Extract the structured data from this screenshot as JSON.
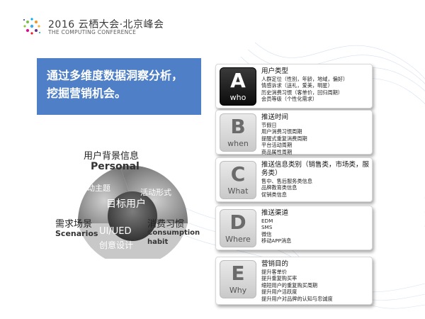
{
  "logo": {
    "title": "2016 云栖大会·北京峰会",
    "subtitle": "THE COMPUTING CONFERENCE"
  },
  "headline": {
    "line1": "通过多维度数据洞察分析，",
    "line2": "挖掘营销机会。"
  },
  "cards": [
    {
      "letter": "A",
      "word": "who",
      "active": true,
      "title": "用户类型",
      "lines": [
        "人群定位（性别，年龄，地域，偏好）",
        "情感诉求（送礼，爱美，明星）",
        "历史消费习惯（客单价，回归周期）",
        "会员等级（个性化需求）"
      ]
    },
    {
      "letter": "B",
      "word": "when",
      "active": false,
      "title": "推送时间",
      "lines": [
        "节假日",
        "用户消费习惯周期",
        "提醒式重复消费周期",
        "平台活动周期",
        "商品属性周期"
      ]
    },
    {
      "letter": "C",
      "word": "What",
      "active": false,
      "title": "推送信息类别（销售类，市场类，服务类）",
      "lines": [
        "售中、售后服务类信息",
        "品牌教育类信息",
        "促销类信息"
      ]
    },
    {
      "letter": "D",
      "word": "Where",
      "active": false,
      "title": "推送渠道",
      "lines": [
        "EDM",
        "SMS",
        "微信",
        "移动APP消息"
      ]
    },
    {
      "letter": "E",
      "word": "Why",
      "active": false,
      "title": "营销目的",
      "lines": [
        "提升客单价",
        "提升重复购买率",
        "缩短用户的重复购买周期",
        "提升用户活跃度",
        "提升用户对品牌的认知与忠诚度"
      ]
    }
  ],
  "diagram": {
    "top_cn": "用户背景信息",
    "top_en": "Personal",
    "center": "目标用户",
    "seg_left": "活动主题",
    "seg_right": "活动形式",
    "left_cn": "需求场景",
    "left_en": "Scenarios",
    "bottom_main": "UI/UED",
    "bottom_sub": "创意设计",
    "right_cn": "消费习惯",
    "right_en1": "Consumption",
    "right_en2": "habit"
  },
  "colors": {
    "headline_bg": "#4f7fc7",
    "card_active": "#111111",
    "card_inactive": "#d6d6d6"
  }
}
